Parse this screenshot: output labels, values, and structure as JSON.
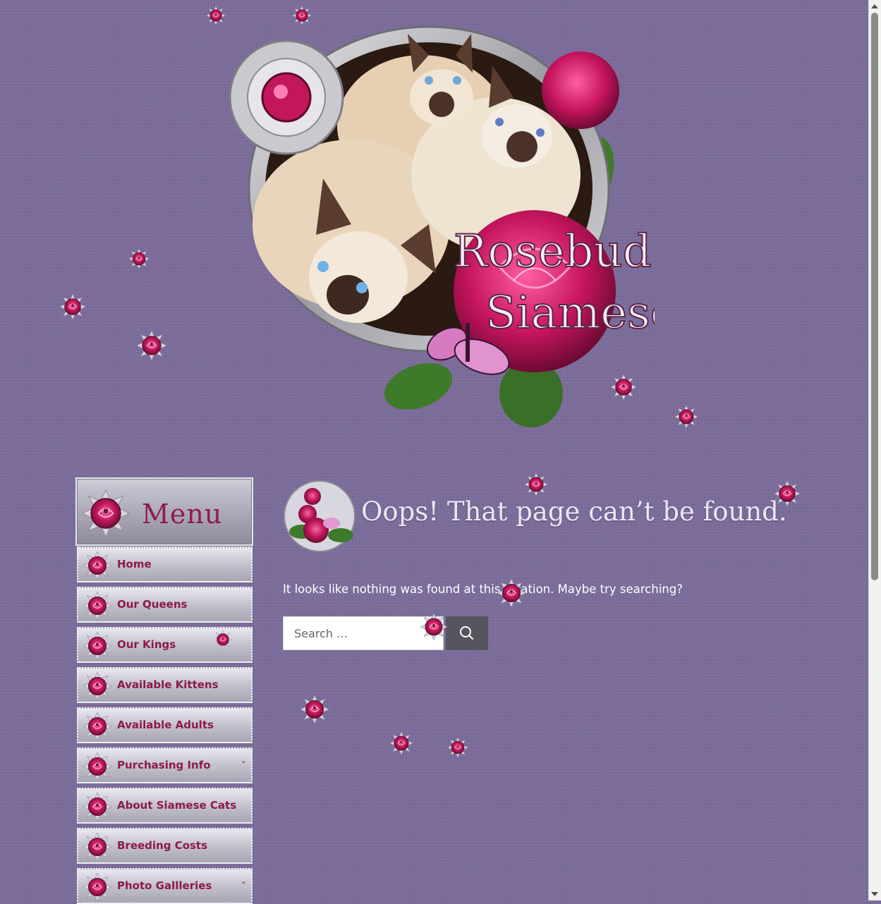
{
  "site": {
    "logo_line1": "Rosebud's",
    "logo_line2": "Siamese"
  },
  "sidebar": {
    "title": "Menu",
    "items": [
      {
        "label": "Home"
      },
      {
        "label": "Our Queens"
      },
      {
        "label": "Our Kings"
      },
      {
        "label": "Available Kittens"
      },
      {
        "label": "Available Adults"
      },
      {
        "label": "Purchasing Info",
        "has_submenu": true
      },
      {
        "label": "About Siamese Cats"
      },
      {
        "label": "Breeding Costs"
      },
      {
        "label": "Photo Gallleries",
        "has_submenu": true
      }
    ],
    "chevron": "⌄"
  },
  "main": {
    "title": "Oops! That page can’t be found.",
    "message": "It looks like nothing was found at this location. Maybe try searching?",
    "search": {
      "placeholder": "Search …",
      "button_icon": "search-icon"
    }
  },
  "colors": {
    "background": "#7b6c9a",
    "accent": "#8c1a4c",
    "title_text": "#ece6f3",
    "search_button": "#55555e"
  }
}
